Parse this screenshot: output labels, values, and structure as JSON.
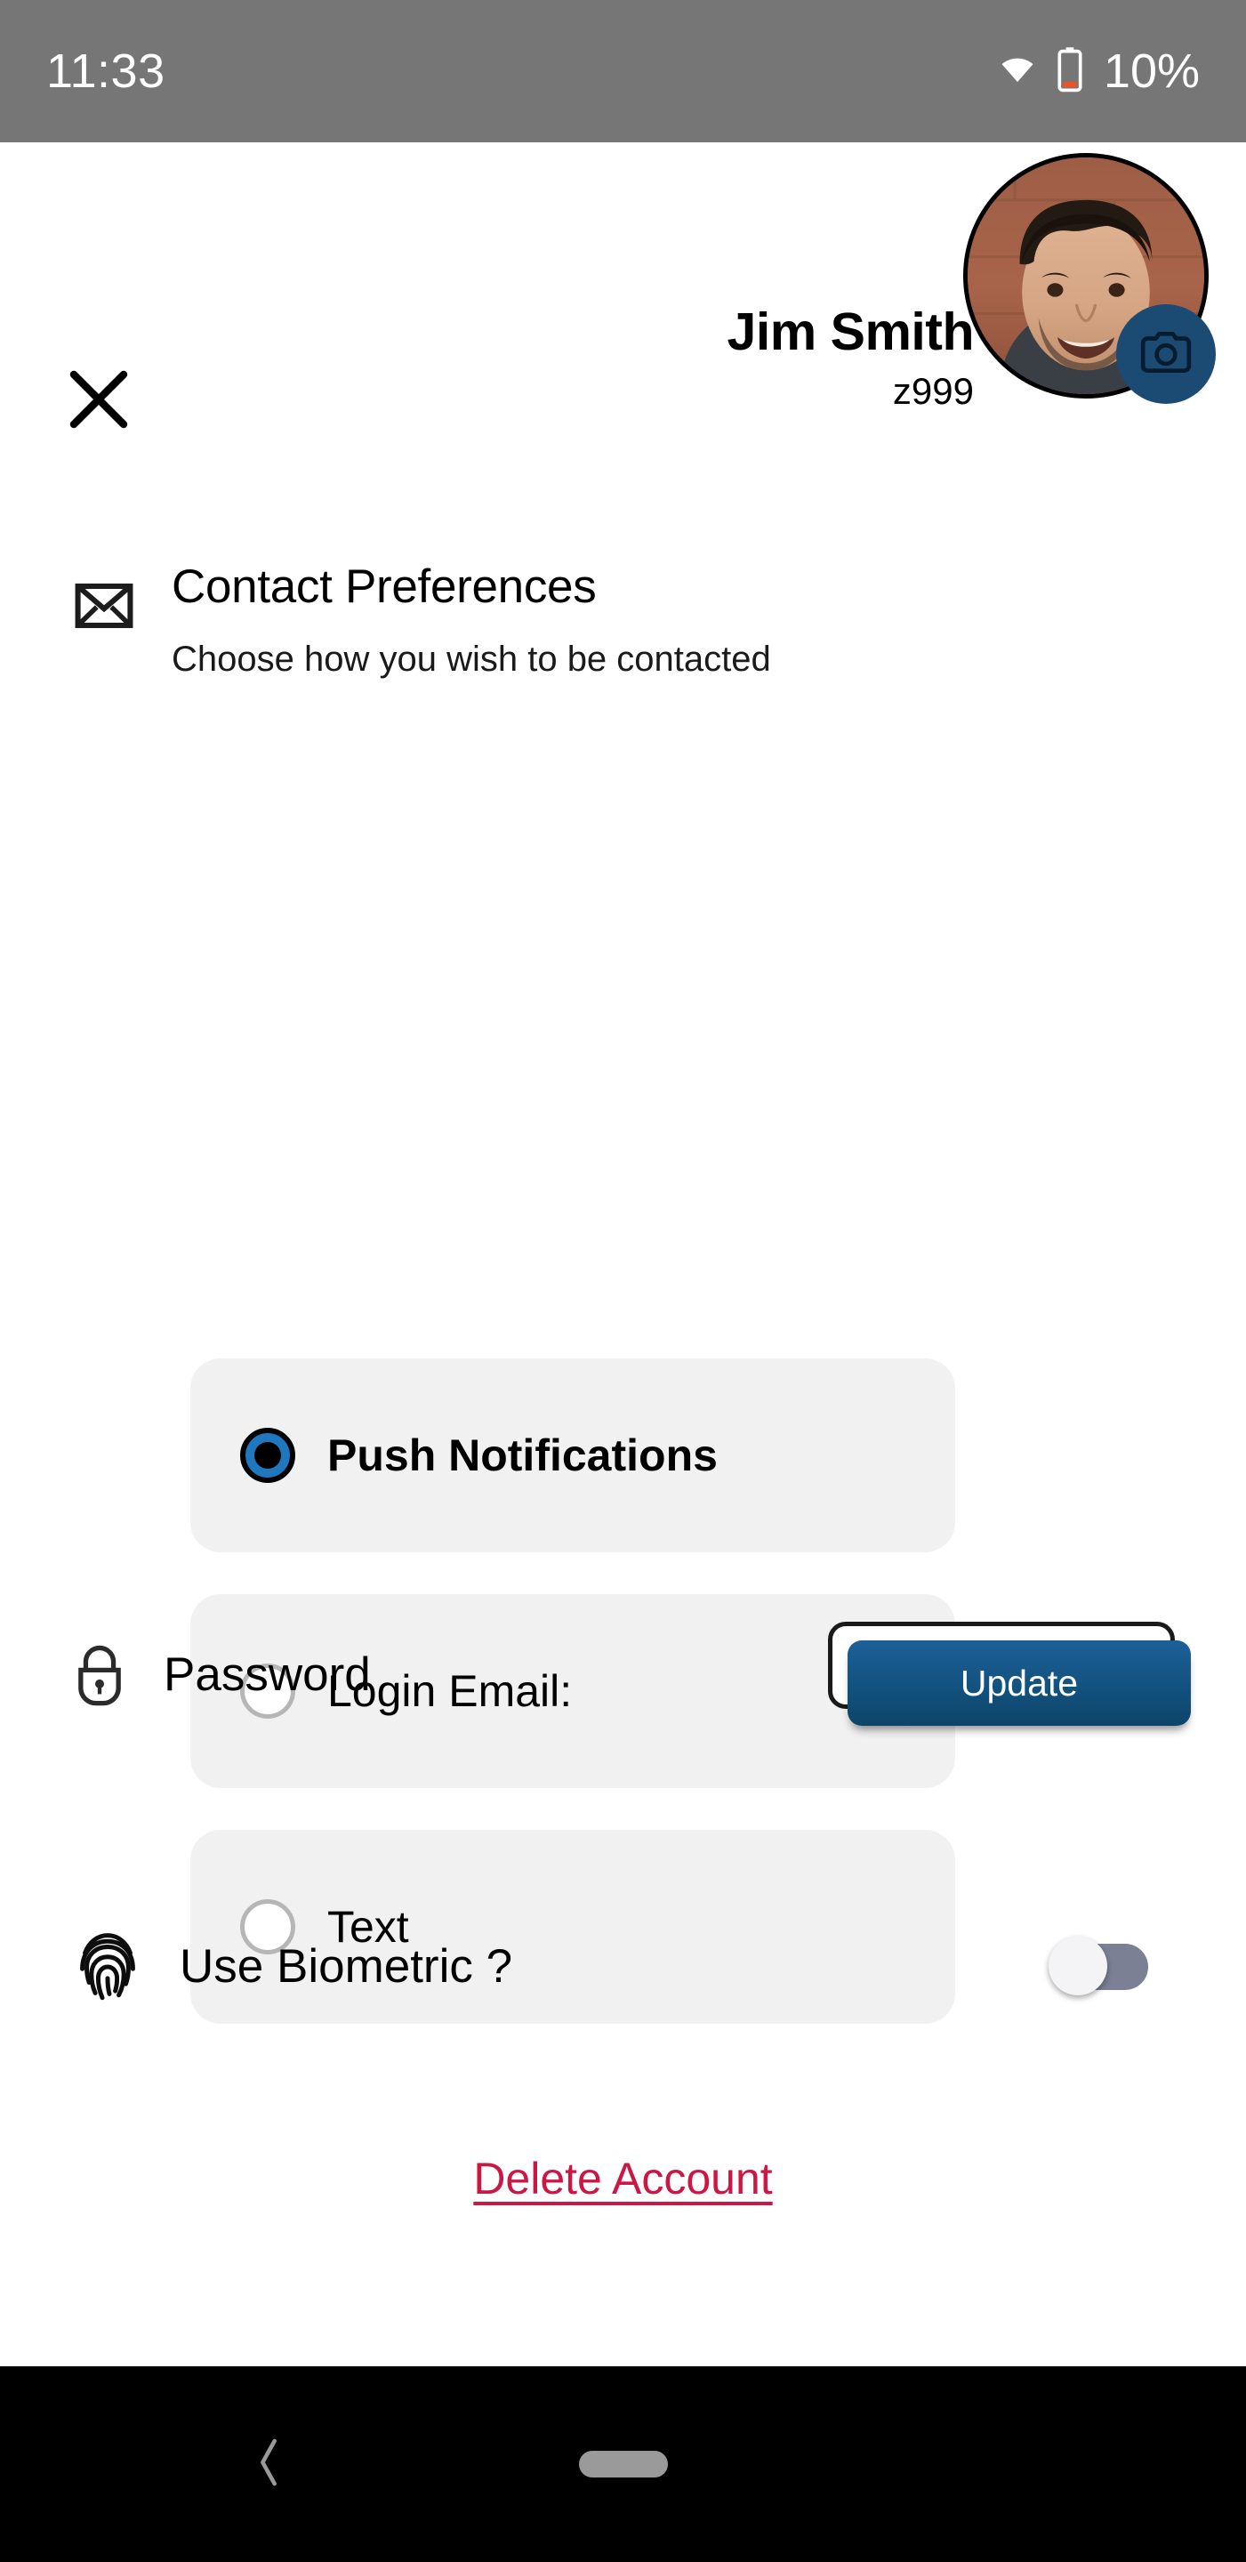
{
  "status_bar": {
    "time": "11:33",
    "battery_percent": "10%",
    "wifi_icon": "wifi-icon",
    "battery_icon": "battery-low-icon",
    "background_color": "#767676",
    "text_color": "#ffffff"
  },
  "header": {
    "close_icon": "close-x-icon",
    "user_name": "Jim Smith",
    "user_id": "z999",
    "avatar_icon": "user-avatar-photo",
    "camera_badge_icon": "camera-icon",
    "camera_badge_color": "#1b4a73"
  },
  "contact_section": {
    "mail_icon": "envelope-icon",
    "title": "Contact Preferences",
    "subtitle": "Choose how you wish to be contacted",
    "options": [
      {
        "label": "Push Notifications",
        "selected": true
      },
      {
        "label": "Login Email:",
        "selected": false
      },
      {
        "label": "Text",
        "selected": false
      }
    ],
    "selected_radio_color": "#1f77be",
    "card_background": "#f1f1f1"
  },
  "password_row": {
    "lock_icon": "lock-icon",
    "label": "Password",
    "button_label": "Update",
    "button_color": "#12527f"
  },
  "biometric_row": {
    "fingerprint_icon": "fingerprint-icon",
    "label": "Use Biometric ?",
    "toggle_state": "off",
    "toggle_track_color": "#7b8095"
  },
  "delete_account": {
    "label": "Delete Account",
    "color": "#cc1745"
  },
  "nav_bar": {
    "back_icon": "back-chevron-icon",
    "home_icon": "home-pill-icon",
    "background_color": "#000000"
  }
}
